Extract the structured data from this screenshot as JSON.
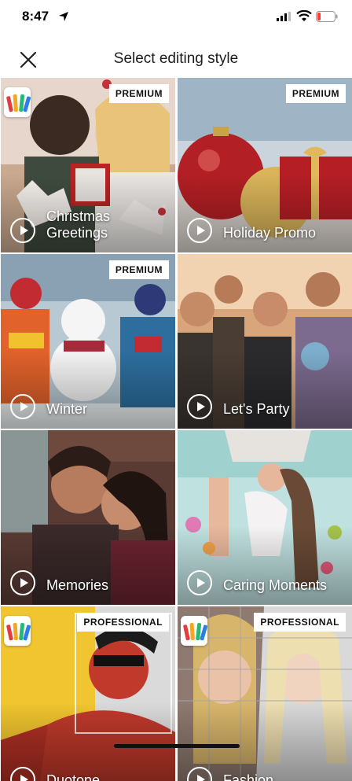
{
  "status_bar": {
    "time": "8:47"
  },
  "nav": {
    "title": "Select editing style"
  },
  "tiles": [
    {
      "label": "Christmas\nGreetings",
      "badge": "PREMIUM",
      "has_logo": true
    },
    {
      "label": "Holiday Promo",
      "badge": "PREMIUM"
    },
    {
      "label": "Winter",
      "badge": "PREMIUM"
    },
    {
      "label": "Let's Party",
      "badge": ""
    },
    {
      "label": "Memories",
      "badge": ""
    },
    {
      "label": "Caring Moments",
      "badge": ""
    },
    {
      "label": "Duotone",
      "badge": "PROFESSIONAL",
      "has_logo": true
    },
    {
      "label": "Fashion",
      "badge": "PROFESSIONAL",
      "has_logo": true
    }
  ]
}
